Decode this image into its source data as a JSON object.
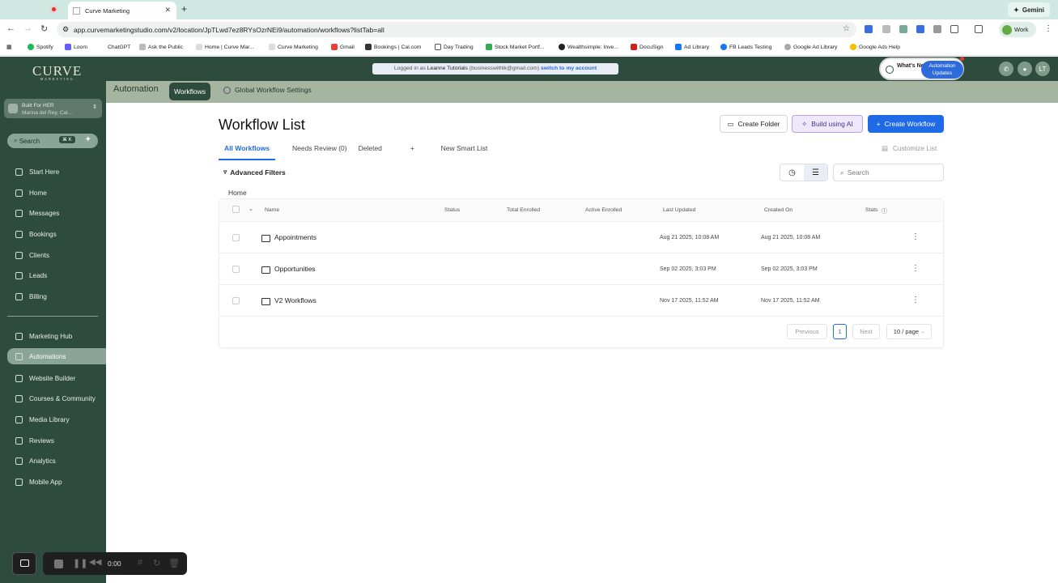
{
  "browser": {
    "tab_title": "Curve Marketing",
    "gemini_label": "Gemini",
    "url": "app.curvemarketingstudio.com/v2/location/JpTLwd7ez8RYsOzrNEi9/automation/workflows?listTab=all",
    "profile_label": "Work",
    "bookmarks": [
      "Spotify",
      "Loom",
      "ChatGPT",
      "Ask the Public",
      "Home | Curve Mar...",
      "Curve Marketing",
      "Gmail",
      "Bookings | Cal.com",
      "Day Trading",
      "Stock Market Portf...",
      "Wealthsimple: Inve...",
      "DocuSign",
      "Ad Library",
      "FB Leads Testing",
      "Google Ad Library",
      "Google Ads Help"
    ]
  },
  "header": {
    "logo": "CURVE",
    "logo_sub": "MARKETING",
    "logged_in_prefix": "Logged in as",
    "logged_in_user": "Leanne Tutorials",
    "logged_in_email": "(businesswithlk@gmail.com)",
    "switch_link": "switch to my account",
    "whats_new": "What's New",
    "updates_label": "Automation Updates",
    "avatar_initials": "LT"
  },
  "sidebar": {
    "location_name": "Built For HER",
    "location_sub": "Marina del Rey, Cal...",
    "search_label": "Search",
    "search_shortcut": "⌘ K",
    "items": [
      {
        "label": "Start Here",
        "icon": "pin-icon"
      },
      {
        "label": "Home",
        "icon": "home-icon"
      },
      {
        "label": "Messages",
        "icon": "chat-icon"
      },
      {
        "label": "Bookings",
        "icon": "calendar-icon"
      },
      {
        "label": "Clients",
        "icon": "clipboard-icon"
      },
      {
        "label": "Leads",
        "icon": "users-icon"
      },
      {
        "label": "Billing",
        "icon": "dollar-icon"
      }
    ],
    "items2": [
      {
        "label": "Marketing Hub",
        "icon": "megaphone-icon"
      },
      {
        "label": "Automations",
        "icon": "automation-icon"
      },
      {
        "label": "Website Builder",
        "icon": "globe-icon"
      },
      {
        "label": "Courses & Community",
        "icon": "people-icon"
      },
      {
        "label": "Media Library",
        "icon": "image-icon"
      },
      {
        "label": "Reviews",
        "icon": "star-icon"
      },
      {
        "label": "Analytics",
        "icon": "chart-icon"
      },
      {
        "label": "Mobile App",
        "icon": "phone-icon"
      }
    ]
  },
  "recorder": {
    "time": "0:00"
  },
  "subheader": {
    "title": "Automation",
    "workflows_tab": "Workflows",
    "global_settings": "Global Workflow Settings"
  },
  "main": {
    "page_title": "Workflow List",
    "create_folder": "Create Folder",
    "build_ai": "Build using AI",
    "create_workflow": "Create Workflow",
    "tabs": [
      "All Workflows",
      "Needs Review (0)",
      "Deleted"
    ],
    "new_smart_list": "New Smart List",
    "customize_list": "Customize List",
    "advanced_filters": "Advanced Filters",
    "search_placeholder": "Search",
    "breadcrumb": "Home",
    "columns": [
      "Name",
      "Status",
      "Total Enrolled",
      "Active Enrolled",
      "Last Updated",
      "Created On",
      "Stats"
    ],
    "rows": [
      {
        "name": "Appointments",
        "last_updated": "Aug 21 2025, 10:08 AM",
        "created_on": "Aug 21 2025, 10:08 AM"
      },
      {
        "name": "Opportunities",
        "last_updated": "Sep 02 2025, 3:03 PM",
        "created_on": "Sep 02 2025, 3:03 PM"
      },
      {
        "name": "V2 Workflows",
        "last_updated": "Nov 17 2025, 11:52 AM",
        "created_on": "Nov 17 2025, 11:52 AM"
      }
    ],
    "pagination": {
      "previous": "Previous",
      "page": "1",
      "next": "Next",
      "per_page": "10 / page"
    }
  }
}
